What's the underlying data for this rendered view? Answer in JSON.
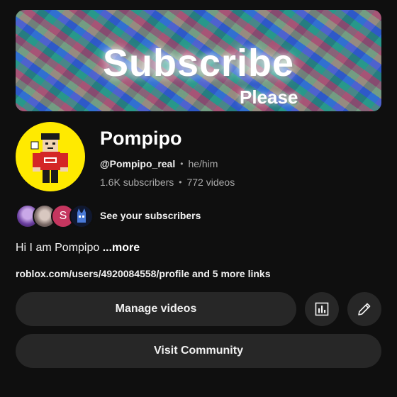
{
  "banner": {
    "title": "Subscribe",
    "subtitle": "Please"
  },
  "channel": {
    "name": "Pompipo",
    "handle": "@Pompipo_real",
    "pronouns": "he/him",
    "subscribers": "1.6K subscribers",
    "videos": "772 videos",
    "separator": "•"
  },
  "subscribers_row": {
    "avatar_initial": "S",
    "label": "See your subscribers"
  },
  "bio": {
    "text": "Hi I am Pompipo ",
    "more": "...more"
  },
  "links": {
    "text": "roblox.com/users/4920084558/profile and 5 more links"
  },
  "actions": {
    "manage_videos": "Manage videos",
    "stats_icon": "bar-chart-icon",
    "edit_icon": "pencil-icon",
    "visit_community": "Visit Community"
  },
  "colors": {
    "background": "#0f0f0f",
    "button": "#272727",
    "avatar_bg": "#ffea00",
    "secondary_text": "#aaaaaa"
  }
}
